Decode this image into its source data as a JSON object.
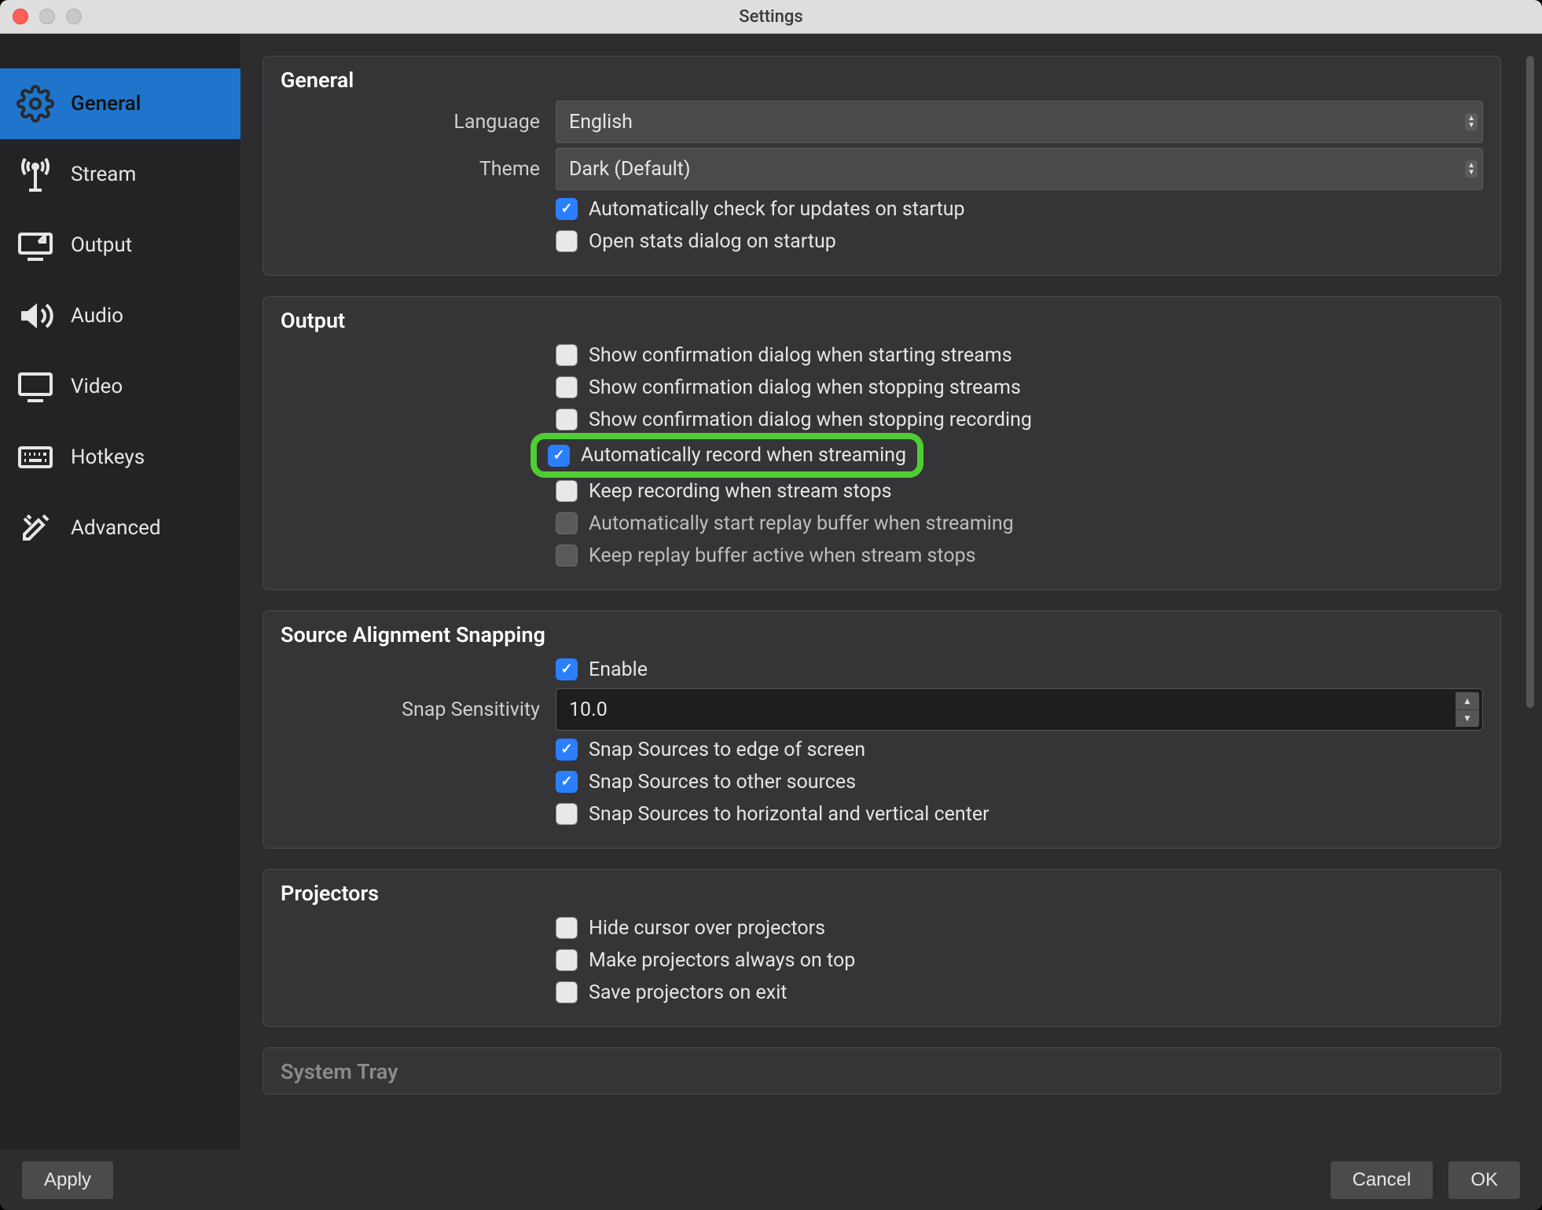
{
  "window": {
    "title": "Settings"
  },
  "sidebar": {
    "items": [
      {
        "label": "General",
        "icon": "gear",
        "selected": true
      },
      {
        "label": "Stream",
        "icon": "antenna",
        "selected": false
      },
      {
        "label": "Output",
        "icon": "output",
        "selected": false
      },
      {
        "label": "Audio",
        "icon": "speaker",
        "selected": false
      },
      {
        "label": "Video",
        "icon": "monitor",
        "selected": false
      },
      {
        "label": "Hotkeys",
        "icon": "keyboard",
        "selected": false
      },
      {
        "label": "Advanced",
        "icon": "tools",
        "selected": false
      }
    ]
  },
  "sections": {
    "general": {
      "title": "General",
      "language_label": "Language",
      "language_value": "English",
      "theme_label": "Theme",
      "theme_value": "Dark (Default)",
      "check_updates": {
        "label": "Automatically check for updates on startup",
        "checked": true
      },
      "open_stats": {
        "label": "Open stats dialog on startup",
        "checked": false
      }
    },
    "output": {
      "title": "Output",
      "items": [
        {
          "key": "confirm_start_stream",
          "label": "Show confirmation dialog when starting streams",
          "checked": false,
          "disabled": false
        },
        {
          "key": "confirm_stop_stream",
          "label": "Show confirmation dialog when stopping streams",
          "checked": false,
          "disabled": false
        },
        {
          "key": "confirm_stop_recording",
          "label": "Show confirmation dialog when stopping recording",
          "checked": false,
          "disabled": false
        },
        {
          "key": "auto_record_stream",
          "label": "Automatically record when streaming",
          "checked": true,
          "disabled": false,
          "highlight": true
        },
        {
          "key": "keep_rec_stream_stop",
          "label": "Keep recording when stream stops",
          "checked": false,
          "disabled": false
        },
        {
          "key": "auto_replay_buffer",
          "label": "Automatically start replay buffer when streaming",
          "checked": false,
          "disabled": true
        },
        {
          "key": "keep_replay_buffer",
          "label": "Keep replay buffer active when stream stops",
          "checked": false,
          "disabled": true
        }
      ]
    },
    "snapping": {
      "title": "Source Alignment Snapping",
      "enable": {
        "label": "Enable",
        "checked": true
      },
      "sensitivity_label": "Snap Sensitivity",
      "sensitivity_value": "10.0",
      "items": [
        {
          "key": "snap_edge",
          "label": "Snap Sources to edge of screen",
          "checked": true
        },
        {
          "key": "snap_other",
          "label": "Snap Sources to other sources",
          "checked": true
        },
        {
          "key": "snap_center",
          "label": "Snap Sources to horizontal and vertical center",
          "checked": false
        }
      ]
    },
    "projectors": {
      "title": "Projectors",
      "items": [
        {
          "key": "hide_cursor",
          "label": "Hide cursor over projectors",
          "checked": false
        },
        {
          "key": "always_top",
          "label": "Make projectors always on top",
          "checked": false
        },
        {
          "key": "save_exit",
          "label": "Save projectors on exit",
          "checked": false
        }
      ]
    },
    "system_tray": {
      "title": "System Tray"
    }
  },
  "buttons": {
    "apply": "Apply",
    "cancel": "Cancel",
    "ok": "OK"
  }
}
